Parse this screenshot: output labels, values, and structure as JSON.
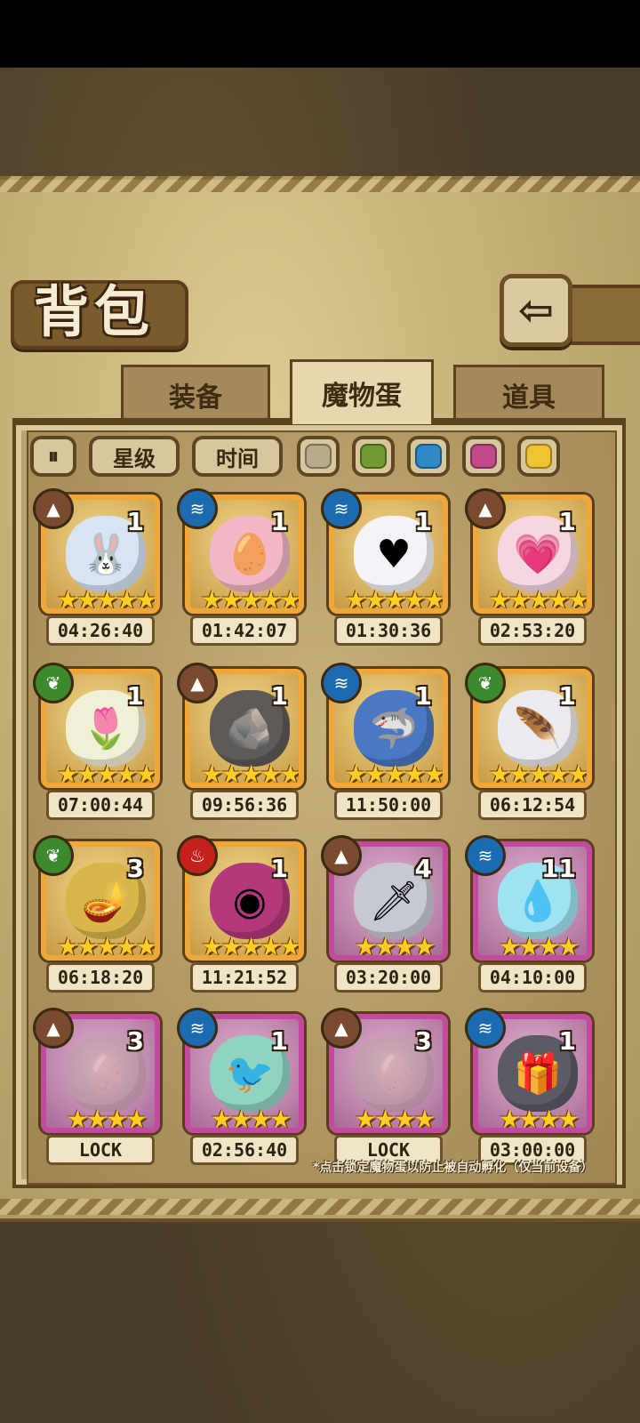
{
  "header": {
    "title": "背包",
    "back_icon": "⇦"
  },
  "tabs": [
    {
      "label": "装备",
      "active": false
    },
    {
      "label": "魔物蛋",
      "active": true
    },
    {
      "label": "道具",
      "active": false
    }
  ],
  "filters": {
    "sort_icon": "⏸",
    "star_label": "星级",
    "time_label": "时间",
    "swatches": [
      "#b8ab8c",
      "#6f9b32",
      "#2f89c6",
      "#c04a8c",
      "#f0c333"
    ]
  },
  "eggs": [
    {
      "element": "earth",
      "count": "1",
      "stars": "★★★★★",
      "timer": "04:26:40",
      "rarity": "gold",
      "color": "#d6e4f4",
      "icon": "🐰"
    },
    {
      "element": "water",
      "count": "1",
      "stars": "★★★★★",
      "timer": "01:42:07",
      "rarity": "gold",
      "color": "#f2b6c6",
      "icon": "🥚"
    },
    {
      "element": "water",
      "count": "1",
      "stars": "★★★★★",
      "timer": "01:30:36",
      "rarity": "gold",
      "color": "#f3f3f8",
      "icon": "♥"
    },
    {
      "element": "earth",
      "count": "1",
      "stars": "★★★★★",
      "timer": "02:53:20",
      "rarity": "gold",
      "color": "#f6d7e1",
      "icon": "💗"
    },
    {
      "element": "wood",
      "count": "1",
      "stars": "★★★★★",
      "timer": "07:00:44",
      "rarity": "gold",
      "color": "#f2efd7",
      "icon": "🌷"
    },
    {
      "element": "earth",
      "count": "1",
      "stars": "★★★★★",
      "timer": "09:56:36",
      "rarity": "gold",
      "color": "#5d5a58",
      "icon": "🪨"
    },
    {
      "element": "water",
      "count": "1",
      "stars": "★★★★★",
      "timer": "11:50:00",
      "rarity": "gold",
      "color": "#4a78c4",
      "icon": "🦈"
    },
    {
      "element": "wood",
      "count": "1",
      "stars": "★★★★★",
      "timer": "06:12:54",
      "rarity": "gold",
      "color": "#eaeaf0",
      "icon": "🪶"
    },
    {
      "element": "wood",
      "count": "3",
      "stars": "★★★★★",
      "timer": "06:18:20",
      "rarity": "gold",
      "color": "#d9b54a",
      "icon": "🪔"
    },
    {
      "element": "fire",
      "count": "1",
      "stars": "★★★★★",
      "timer": "11:21:52",
      "rarity": "gold",
      "color": "#b4397c",
      "icon": "◉"
    },
    {
      "element": "earth",
      "count": "4",
      "stars": "★★★★",
      "timer": "03:20:00",
      "rarity": "purple",
      "color": "#c7c9d2",
      "icon": "🗡"
    },
    {
      "element": "water",
      "count": "11",
      "stars": "★★★★",
      "timer": "04:10:00",
      "rarity": "purple",
      "color": "#9fe3f2",
      "icon": "💧"
    },
    {
      "element": "earth",
      "count": "3",
      "stars": "★★★★",
      "timer": "LOCK",
      "rarity": "purple",
      "color": "#b9a47c",
      "icon": "🥚",
      "locked": true
    },
    {
      "element": "water",
      "count": "1",
      "stars": "★★★★",
      "timer": "02:56:40",
      "rarity": "purple",
      "color": "#8fd3c2",
      "icon": "🐦"
    },
    {
      "element": "earth",
      "count": "3",
      "stars": "★★★★",
      "timer": "LOCK",
      "rarity": "purple",
      "color": "#b9a47c",
      "icon": "🥚",
      "locked": true
    },
    {
      "element": "water",
      "count": "1",
      "stars": "★★★★",
      "timer": "03:00:00",
      "rarity": "purple",
      "color": "#5b5b66",
      "icon": "🎁"
    }
  ],
  "element_icons": {
    "earth": "▲",
    "water": "≋",
    "wood": "❦",
    "fire": "♨"
  },
  "hint": "*点击锁定魔物蛋以防止被自动孵化（仅当前设备）"
}
